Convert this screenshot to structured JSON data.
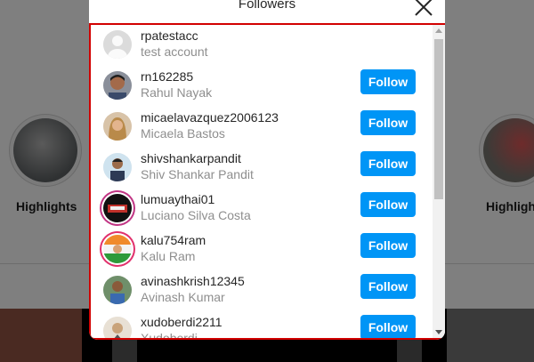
{
  "modal": {
    "title": "Followers"
  },
  "background": {
    "highlight_label_left": "Highlights",
    "highlight_label_right": "Highligh"
  },
  "followers": [
    {
      "username": "rpatestacc",
      "full_name": "test account",
      "button": ""
    },
    {
      "username": "rn162285",
      "full_name": "Rahul Nayak",
      "button": "Follow"
    },
    {
      "username": "micaelavazquez2006123",
      "full_name": "Micaela Bastos",
      "button": "Follow"
    },
    {
      "username": "shivshankarpandit",
      "full_name": "Shiv Shankar Pandit",
      "button": "Follow"
    },
    {
      "username": "lumuaythai01",
      "full_name": "Luciano Silva Costa",
      "button": "Follow"
    },
    {
      "username": "kalu754ram",
      "full_name": "Kalu Ram",
      "button": "Follow"
    },
    {
      "username": "avinashkrish12345",
      "full_name": "Avinash Kumar",
      "button": "Follow"
    },
    {
      "username": "xudoberdi2211",
      "full_name": "Xudoberdi",
      "button": "Follow"
    }
  ],
  "colors": {
    "follow_button": "#0095f6",
    "highlight_border": "#d20000"
  }
}
